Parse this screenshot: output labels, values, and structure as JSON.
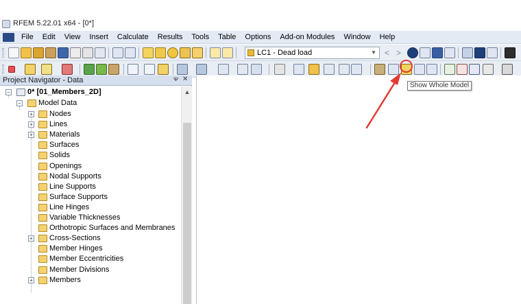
{
  "window": {
    "title": "RFEM 5.22.01 x64 - [0*]"
  },
  "menu": {
    "items": [
      "File",
      "Edit",
      "View",
      "Insert",
      "Calculate",
      "Results",
      "Tools",
      "Table",
      "Options",
      "Add-on Modules",
      "Window",
      "Help"
    ]
  },
  "toolbar": {
    "load_case": {
      "value": "LC1 - Dead load"
    }
  },
  "tooltip": {
    "text": "Show Whole Model"
  },
  "navigator": {
    "title": "Project Navigator - Data",
    "project": "0* [01_Members_2D]",
    "root": "Model Data",
    "items": [
      {
        "label": "Nodes",
        "expandable": true
      },
      {
        "label": "Lines",
        "expandable": true
      },
      {
        "label": "Materials",
        "expandable": true
      },
      {
        "label": "Surfaces",
        "expandable": false
      },
      {
        "label": "Solids",
        "expandable": false
      },
      {
        "label": "Openings",
        "expandable": false
      },
      {
        "label": "Nodal Supports",
        "expandable": false
      },
      {
        "label": "Line Supports",
        "expandable": false
      },
      {
        "label": "Surface Supports",
        "expandable": false
      },
      {
        "label": "Line Hinges",
        "expandable": false
      },
      {
        "label": "Variable Thicknesses",
        "expandable": false
      },
      {
        "label": "Orthotropic Surfaces and Membranes",
        "expandable": false
      },
      {
        "label": "Cross-Sections",
        "expandable": true
      },
      {
        "label": "Member Hinges",
        "expandable": false
      },
      {
        "label": "Member Eccentricities",
        "expandable": false
      },
      {
        "label": "Member Divisions",
        "expandable": false
      },
      {
        "label": "Members",
        "expandable": true
      }
    ]
  },
  "colors": {
    "accent_red": "#e53935",
    "folder": "#f3d271"
  }
}
